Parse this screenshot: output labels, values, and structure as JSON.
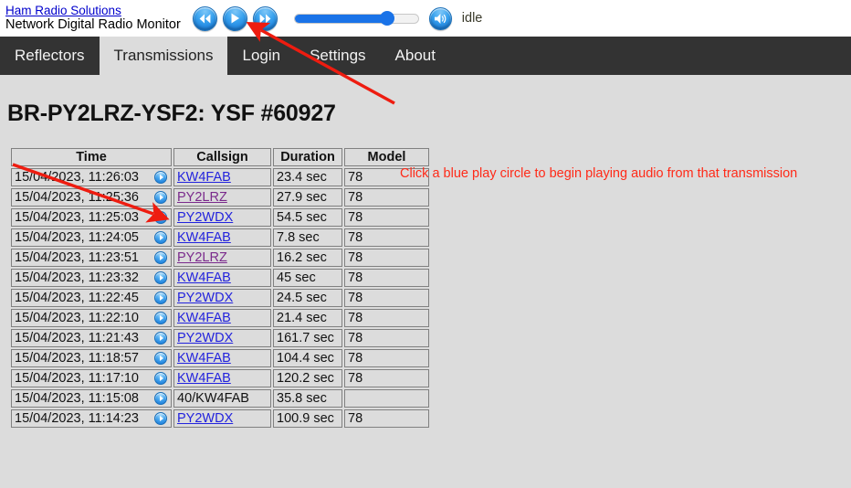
{
  "header": {
    "brand_link": "Ham Radio Solutions",
    "brand_subtitle": "Network Digital Radio Monitor",
    "player": {
      "rewind_label": "rewind-button",
      "play_label": "play-button",
      "forward_label": "fast-forward-button",
      "volume_label": "volume-button",
      "seek_percent": 75,
      "status": "idle"
    }
  },
  "nav": {
    "items": [
      {
        "label": "Reflectors",
        "active": false
      },
      {
        "label": "Transmissions",
        "active": true
      },
      {
        "label": "Login",
        "active": false
      },
      {
        "label": "Settings",
        "active": false
      },
      {
        "label": "About",
        "active": false
      }
    ]
  },
  "annotation": {
    "note": "Click a blue play circle to begin playing audio from that transmission",
    "color": "#ff2a18"
  },
  "main": {
    "title": "BR-PY2LRZ-YSF2: YSF #60927",
    "table": {
      "columns": [
        "Time",
        "Callsign",
        "Duration",
        "Model"
      ],
      "rows": [
        {
          "time": "15/04/2023, 11:26:03",
          "callsign": "KW4FAB",
          "is_link": true,
          "visited": false,
          "duration": "23.4 sec",
          "model": "78"
        },
        {
          "time": "15/04/2023, 11:25:36",
          "callsign": "PY2LRZ",
          "is_link": true,
          "visited": true,
          "duration": "27.9 sec",
          "model": "78"
        },
        {
          "time": "15/04/2023, 11:25:03",
          "callsign": "PY2WDX",
          "is_link": true,
          "visited": false,
          "duration": "54.5 sec",
          "model": "78"
        },
        {
          "time": "15/04/2023, 11:24:05",
          "callsign": "KW4FAB",
          "is_link": true,
          "visited": false,
          "duration": "7.8 sec",
          "model": "78"
        },
        {
          "time": "15/04/2023, 11:23:51",
          "callsign": "PY2LRZ",
          "is_link": true,
          "visited": true,
          "duration": "16.2 sec",
          "model": "78"
        },
        {
          "time": "15/04/2023, 11:23:32",
          "callsign": "KW4FAB",
          "is_link": true,
          "visited": false,
          "duration": "45 sec",
          "model": "78"
        },
        {
          "time": "15/04/2023, 11:22:45",
          "callsign": "PY2WDX",
          "is_link": true,
          "visited": false,
          "duration": "24.5 sec",
          "model": "78"
        },
        {
          "time": "15/04/2023, 11:22:10",
          "callsign": "KW4FAB",
          "is_link": true,
          "visited": false,
          "duration": "21.4 sec",
          "model": "78"
        },
        {
          "time": "15/04/2023, 11:21:43",
          "callsign": "PY2WDX",
          "is_link": true,
          "visited": false,
          "duration": "161.7 sec",
          "model": "78"
        },
        {
          "time": "15/04/2023, 11:18:57",
          "callsign": "KW4FAB",
          "is_link": true,
          "visited": false,
          "duration": "104.4 sec",
          "model": "78"
        },
        {
          "time": "15/04/2023, 11:17:10",
          "callsign": "KW4FAB",
          "is_link": true,
          "visited": false,
          "duration": "120.2 sec",
          "model": "78"
        },
        {
          "time": "15/04/2023, 11:15:08",
          "callsign": "40/KW4FAB",
          "is_link": false,
          "visited": false,
          "duration": "35.8 sec",
          "model": ""
        },
        {
          "time": "15/04/2023, 11:14:23",
          "callsign": "PY2WDX",
          "is_link": true,
          "visited": false,
          "duration": "100.9 sec",
          "model": "78"
        }
      ]
    }
  }
}
